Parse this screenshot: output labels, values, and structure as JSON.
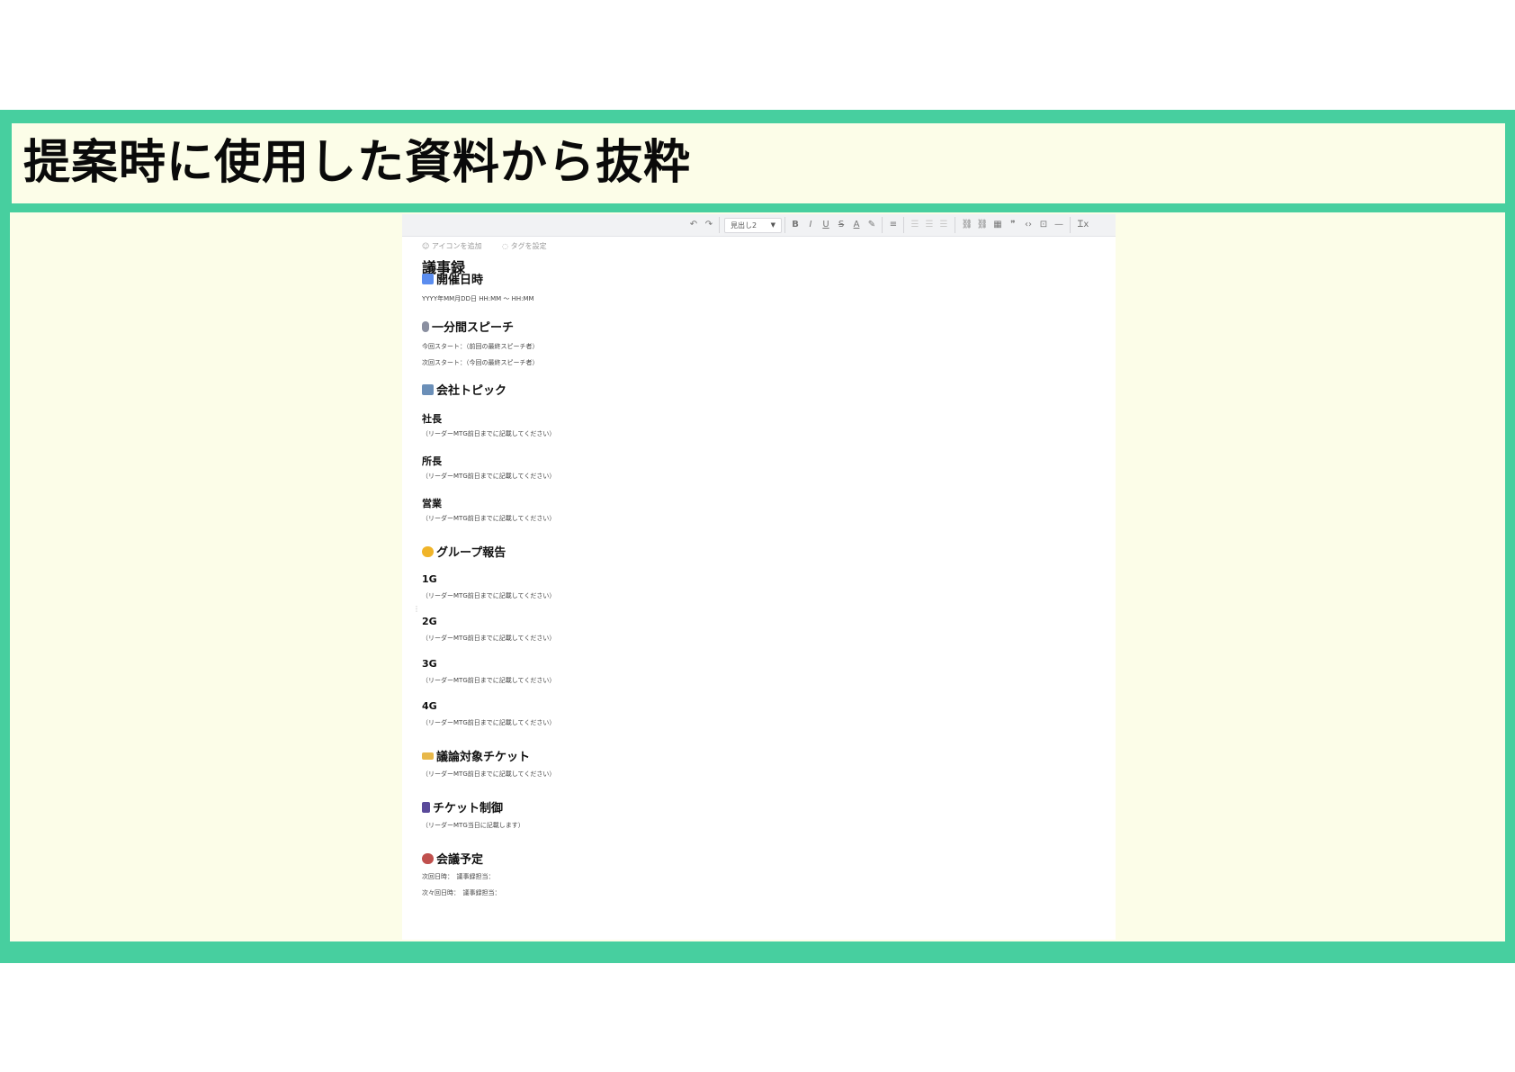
{
  "slide": {
    "title": "提案時に使用した資料から抜粋"
  },
  "toolbar": {
    "undo": "↶",
    "redo": "↷",
    "heading_select": "見出し2",
    "heading_arrow": "▼",
    "bold": "B",
    "italic": "I",
    "underline": "U",
    "strike": "S",
    "text_color": "A",
    "highlight": "✎",
    "align": "≡",
    "list1": "☰",
    "list2": "☰",
    "list3": "☰",
    "link": "⛓",
    "unlink": "⛓",
    "table": "▦",
    "quote": "❞",
    "code": "‹›",
    "embed": "⊡",
    "divider": "—",
    "clear_format": "Ꮖx"
  },
  "doc": {
    "add_icon": "アイコンを追加",
    "add_tag": "タグを設定",
    "title": "議事録",
    "sections": {
      "date": {
        "heading": "開催日時",
        "icon_color": "#5b8def",
        "text": "YYYY年MM月DD日 HH:MM 〜 HH:MM"
      },
      "speech": {
        "heading": "一分間スピーチ",
        "icon_color": "#8a8fa0",
        "line1": "今回スタート：（前回の最終スピーチ者）",
        "line2": "次回スタート：（今回の最終スピーチ者）"
      },
      "company": {
        "heading": "会社トピック",
        "icon_color": "#6b8fb8",
        "sub1": "社長",
        "sub2": "所長",
        "sub3": "営業",
        "note": "（リーダーMTG前日までに記載してください）"
      },
      "group": {
        "heading": "グループ報告",
        "icon_color": "#f0b429",
        "g1": "1G",
        "g2": "2G",
        "g3": "3G",
        "g4": "4G",
        "note": "（リーダーMTG前日までに記載してください）"
      },
      "tickets": {
        "heading": "議論対象チケット",
        "icon_color": "#e8b84a",
        "note": "（リーダーMTG前日までに記載してください）"
      },
      "control": {
        "heading": "チケット制御",
        "icon_color": "#5a4a9a",
        "note": "（リーダーMTG当日に記載します）"
      },
      "meeting": {
        "heading": "会議予定",
        "icon_color": "#c0504d",
        "line1": "次回日時：　議事録担当：",
        "line2": "次々回日時：　議事録担当："
      }
    }
  }
}
